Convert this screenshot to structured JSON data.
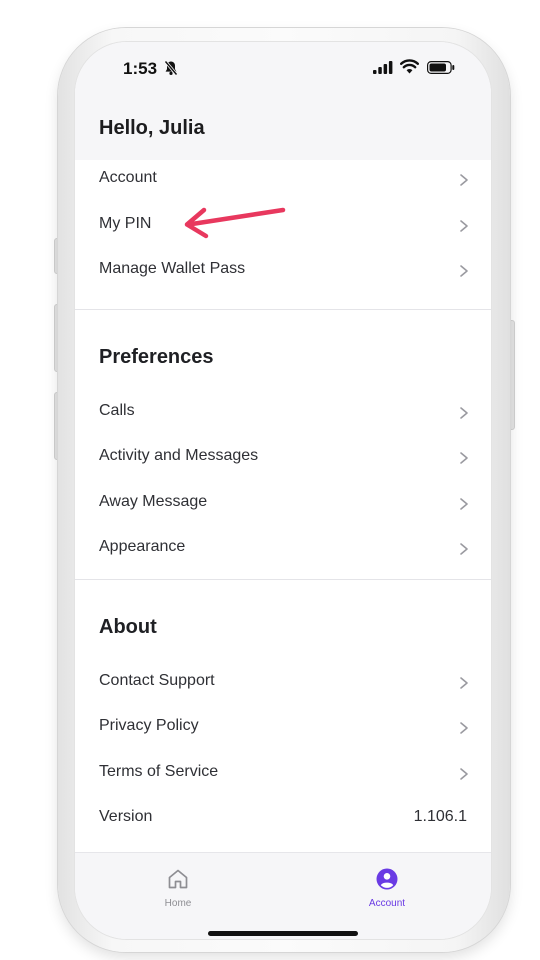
{
  "status": {
    "time": "1:53"
  },
  "greeting": "Hello, Julia",
  "account_items": [
    {
      "label": "Account"
    },
    {
      "label": "My PIN"
    },
    {
      "label": "Manage Wallet Pass"
    }
  ],
  "preferences": {
    "title": "Preferences",
    "items": [
      {
        "label": "Calls"
      },
      {
        "label": "Activity and Messages"
      },
      {
        "label": "Away Message"
      },
      {
        "label": "Appearance"
      }
    ]
  },
  "about": {
    "title": "About",
    "items": [
      {
        "label": "Contact Support"
      },
      {
        "label": "Privacy Policy"
      },
      {
        "label": "Terms of Service"
      }
    ],
    "version_label": "Version",
    "version_value": "1.106.1"
  },
  "tabbar": {
    "home_label": "Home",
    "account_label": "Account"
  },
  "colors": {
    "accent": "#6a3be4",
    "annotation_arrow": "#e8385e",
    "inactive_tab": "#8e8e93"
  },
  "icons": [
    "bell-slash-icon",
    "signal-icon",
    "wifi-icon",
    "battery-icon",
    "chevron-right-icon",
    "home-icon",
    "account-circle-icon"
  ]
}
